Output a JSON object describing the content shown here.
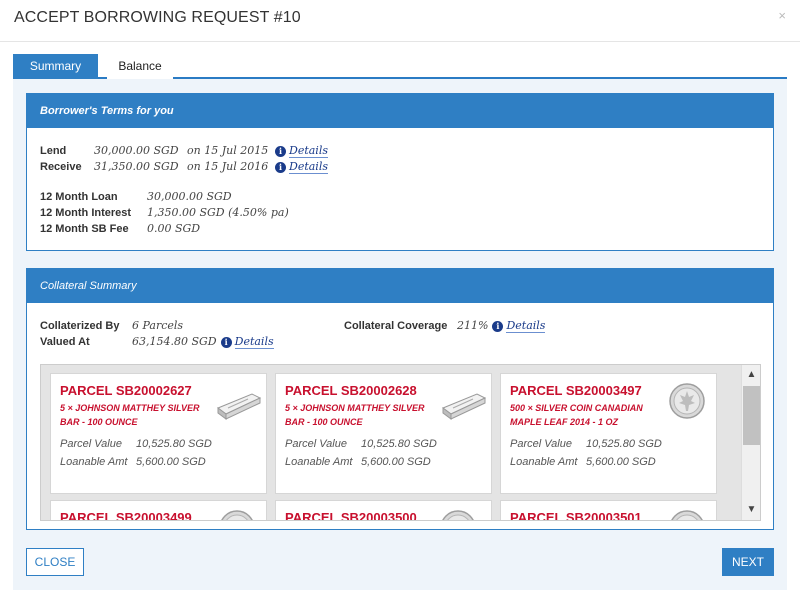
{
  "modal": {
    "title": "ACCEPT BORROWING REQUEST #10",
    "close_symbol": "×"
  },
  "tabs": [
    {
      "label": "Summary",
      "active": true
    },
    {
      "label": "Balance",
      "active": false
    }
  ],
  "terms": {
    "heading": "Borrower's Terms for you",
    "lend": {
      "label": "Lend",
      "amount": "30,000.00 SGD",
      "date": "on 15 Jul 2015",
      "link": "Details"
    },
    "receive": {
      "label": "Receive",
      "amount": "31,350.00 SGD",
      "date": "on 15 Jul 2016",
      "link": "Details"
    },
    "loan": {
      "label": "12 Month Loan",
      "value": "30,000.00 SGD"
    },
    "interest": {
      "label": "12 Month Interest",
      "value": "1,350.00 SGD (4.50% pa)"
    },
    "fee": {
      "label": "12 Month SB Fee",
      "value": "0.00 SGD"
    }
  },
  "collateral": {
    "heading": "Collateral Summary",
    "collateralized_by": {
      "label": "Collaterized By",
      "value": "6 Parcels"
    },
    "valued_at": {
      "label": "Valued At",
      "value": "63,154.80 SGD",
      "link": "Details"
    },
    "coverage": {
      "label": "Collateral Coverage",
      "value": "211%",
      "link": "Details"
    }
  },
  "parcels": [
    {
      "title": "PARCEL SB20002627",
      "desc": "5 × JOHNSON MATTHEY SILVER BAR - 100 OUNCE",
      "icon": "silver-bar-icon",
      "parcel_value_label": "Parcel Value",
      "parcel_value": "10,525.80 SGD",
      "loanable_label": "Loanable Amt",
      "loanable": "5,600.00 SGD"
    },
    {
      "title": "PARCEL SB20002628",
      "desc": "5 × JOHNSON MATTHEY SILVER BAR - 100 OUNCE",
      "icon": "silver-bar-icon",
      "parcel_value_label": "Parcel Value",
      "parcel_value": "10,525.80 SGD",
      "loanable_label": "Loanable Amt",
      "loanable": "5,600.00 SGD"
    },
    {
      "title": "PARCEL SB20003497",
      "desc": "500 × SILVER COIN CANADIAN MAPLE LEAF 2014 - 1 OZ",
      "icon": "silver-coin-icon",
      "parcel_value_label": "Parcel Value",
      "parcel_value": "10,525.80 SGD",
      "loanable_label": "Loanable Amt",
      "loanable": "5,600.00 SGD"
    },
    {
      "title": "PARCEL SB20003499",
      "icon": "silver-coin-icon"
    },
    {
      "title": "PARCEL SB20003500",
      "icon": "silver-coin-icon"
    },
    {
      "title": "PARCEL SB20003501",
      "icon": "silver-coin-icon"
    }
  ],
  "buttons": {
    "close": "CLOSE",
    "next": "NEXT"
  },
  "colors": {
    "primary": "#2f7fc4",
    "parcel_red": "#c8102e",
    "link": "#1a3b8a"
  }
}
